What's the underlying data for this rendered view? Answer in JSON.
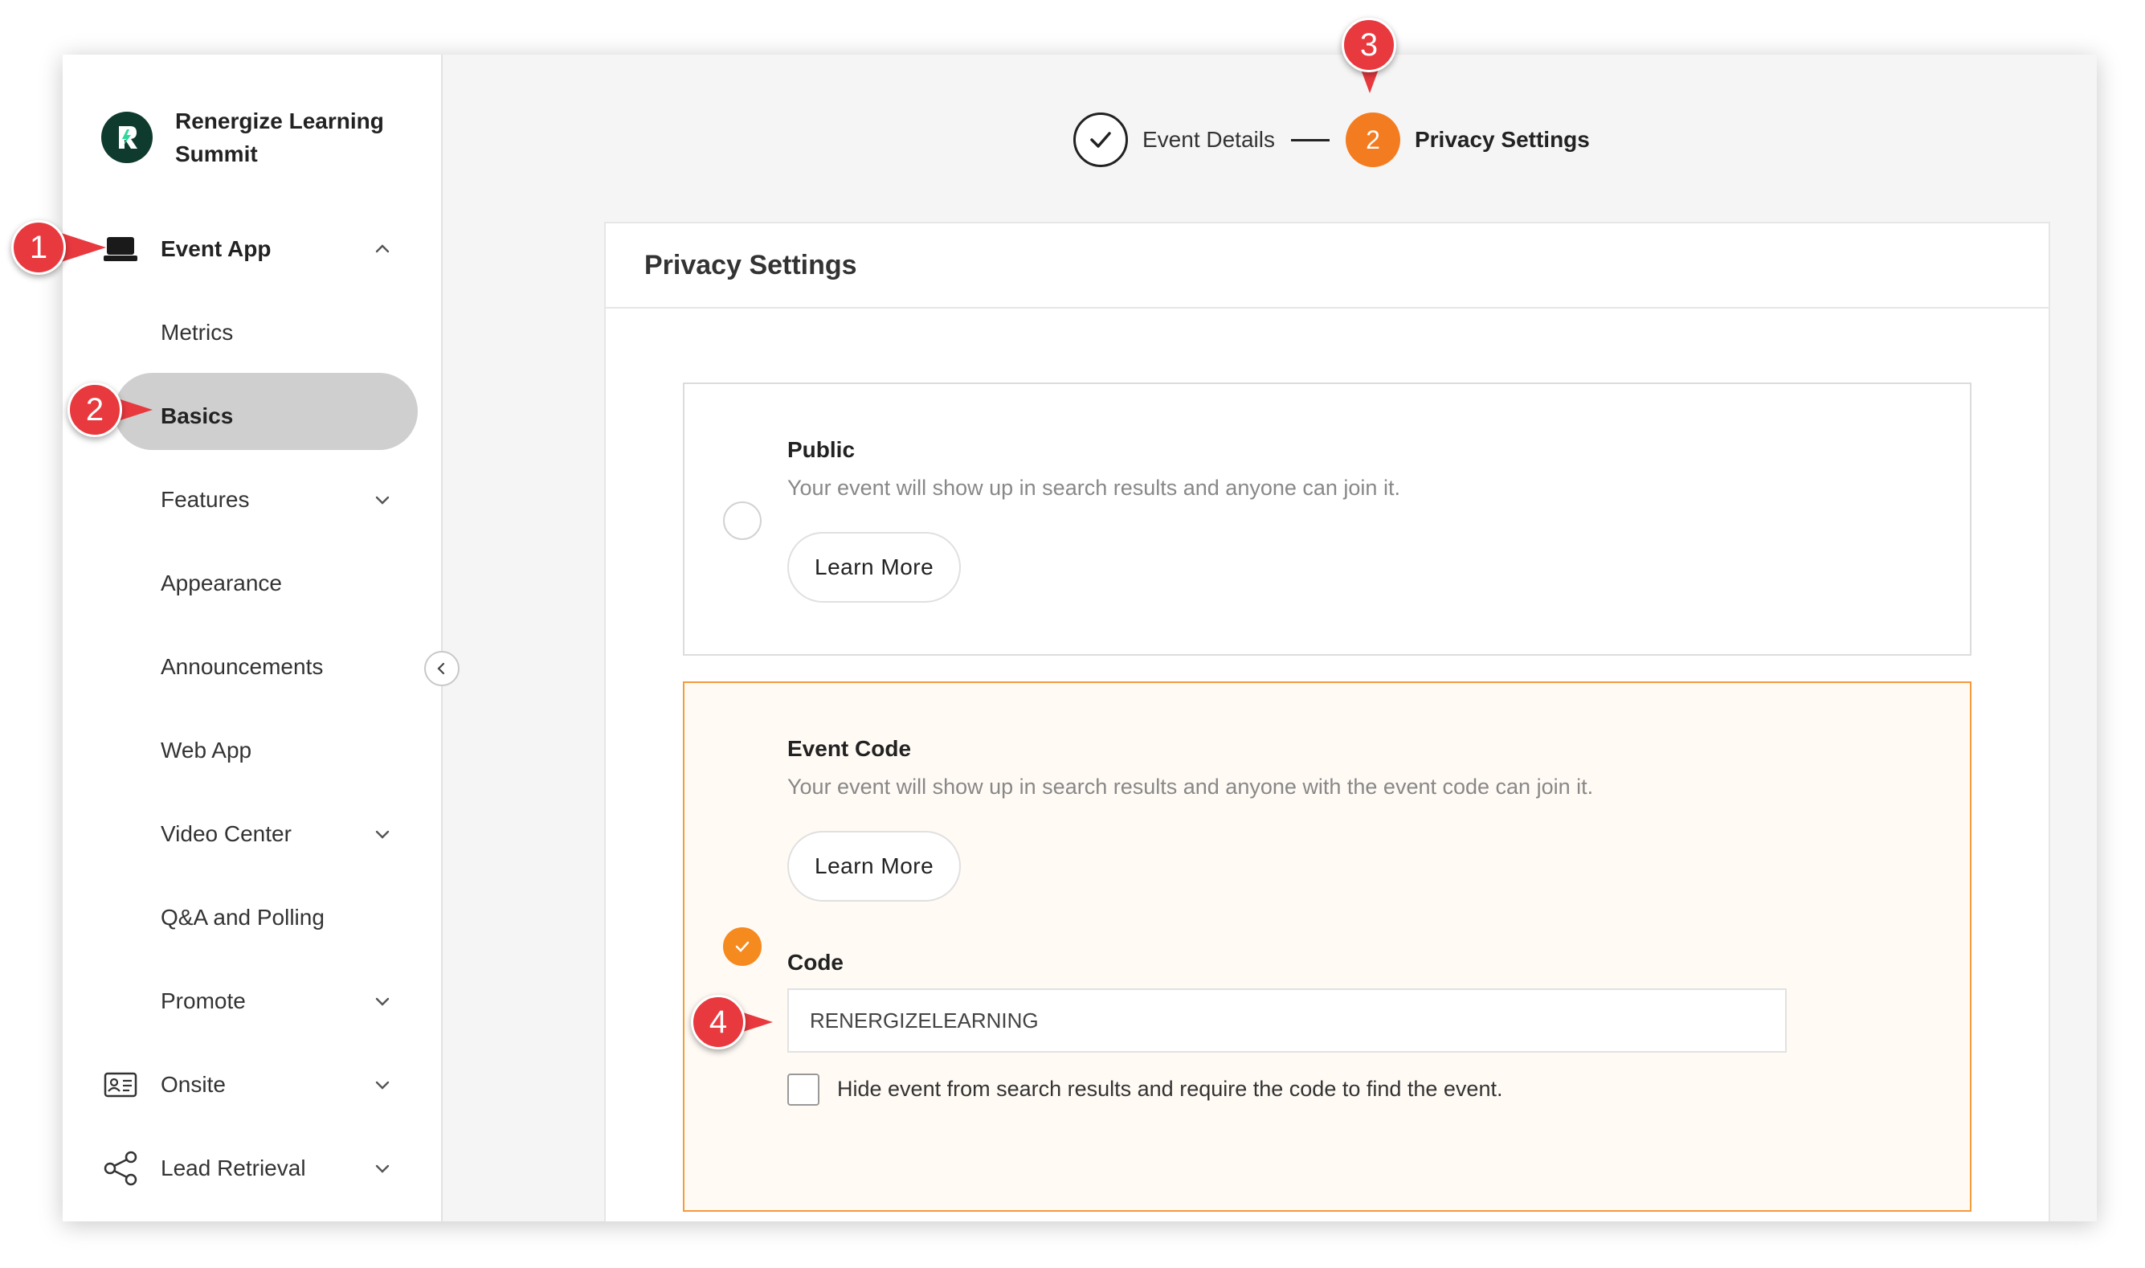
{
  "sidebar": {
    "brand_name": "Renergize Learning Summit",
    "items": [
      {
        "label": "Event App",
        "icon": "laptop-icon",
        "bold": true,
        "chevron": "up"
      },
      {
        "label": "Metrics"
      },
      {
        "label": "Basics",
        "active": true
      },
      {
        "label": "Features",
        "chevron": "down"
      },
      {
        "label": "Appearance"
      },
      {
        "label": "Announcements"
      },
      {
        "label": "Web App"
      },
      {
        "label": "Video Center",
        "chevron": "down"
      },
      {
        "label": "Q&A and Polling"
      },
      {
        "label": "Promote",
        "chevron": "down"
      },
      {
        "label": "Onsite",
        "icon": "id-card-icon",
        "chevron": "down"
      },
      {
        "label": "Lead Retrieval",
        "icon": "share-icon",
        "chevron": "down"
      }
    ]
  },
  "steps": [
    {
      "label": "Event Details",
      "state": "completed"
    },
    {
      "number": "2",
      "label": "Privacy Settings",
      "state": "current"
    }
  ],
  "card": {
    "title": "Privacy Settings",
    "options": [
      {
        "title": "Public",
        "description": "Your event will show up in search results and anyone can join it.",
        "button": "Learn More",
        "selected": false
      },
      {
        "title": "Event Code",
        "description": "Your event will show up in search results and anyone with the event code can join it.",
        "button": "Learn More",
        "selected": true
      }
    ],
    "code_label": "Code",
    "code_value": "RENERGIZELEARNING",
    "hide_checkbox_label": "Hide event from search results and require the code to find the event.",
    "hide_checked": false
  },
  "callouts": [
    "1",
    "2",
    "3",
    "4"
  ],
  "colors": {
    "accent": "#f47c20",
    "callout": "#e8393f",
    "brand": "#0f3b2e"
  }
}
